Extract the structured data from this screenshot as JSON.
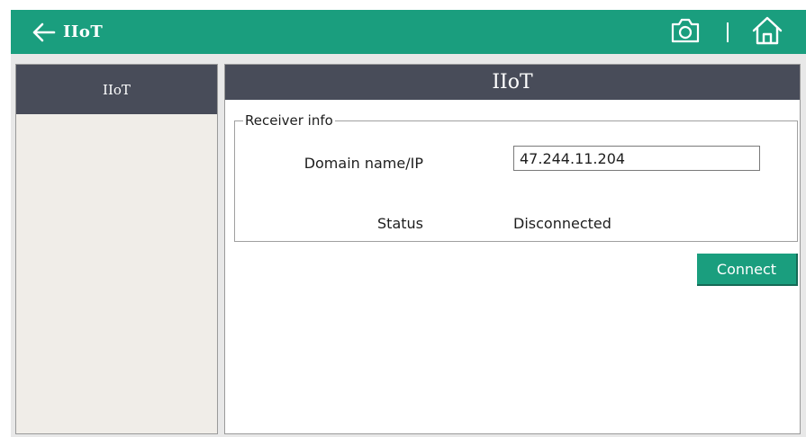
{
  "colors": {
    "accent": "#1a9e7e",
    "header_dark": "#484c59",
    "sidebar_bg": "#f0ede8",
    "text": "#1e1e1e"
  },
  "topbar": {
    "back_icon": "arrow-left-icon",
    "title": "IIoT",
    "camera_icon": "camera-icon",
    "home_icon": "home-icon"
  },
  "sidebar": {
    "items": [
      {
        "label": "IIoT",
        "selected": true
      }
    ]
  },
  "panel": {
    "title": "IIoT",
    "group_title": "Receiver info",
    "domain_label": "Domain name/IP",
    "domain_value": "47.244.11.204",
    "status_label": "Status",
    "status_value": "Disconnected",
    "connect_label": "Connect"
  }
}
